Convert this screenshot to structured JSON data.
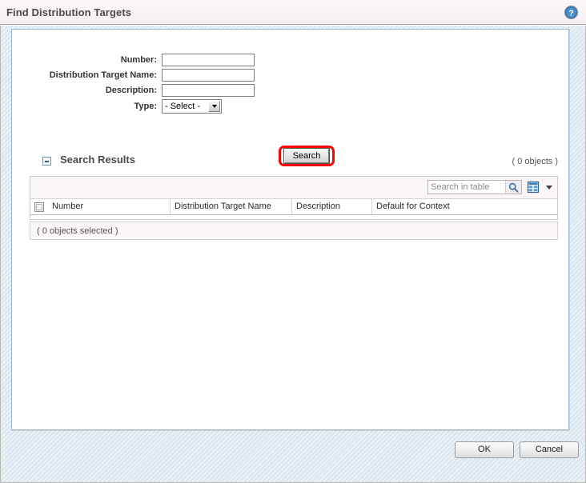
{
  "window": {
    "title": "Find Distribution Targets",
    "help_icon": "help-question-icon"
  },
  "criteria": {
    "fields": [
      {
        "label": "Number:",
        "value": "",
        "placeholder": ""
      },
      {
        "label": "Distribution Target Name:",
        "value": "",
        "placeholder": ""
      },
      {
        "label": "Description:",
        "value": "",
        "placeholder": ""
      }
    ],
    "type_field": {
      "label": "Type:",
      "selected": "- Select -"
    },
    "search_button": "Search"
  },
  "results": {
    "title": "Search Results",
    "collapse_icon": "collapse-minus-icon",
    "object_count": "( 0 objects )",
    "toolbar": {
      "search_placeholder": "Search in table",
      "search_value": "",
      "search_icon": "magnifier-icon",
      "grid_icon": "table-grid-icon",
      "dropdown_icon": "chevron-down-icon"
    },
    "columns": [
      "Number",
      "Distribution Target Name",
      "Description",
      "Default for Context"
    ],
    "rows": [],
    "selected_text": "( 0 objects selected )"
  },
  "footer": {
    "ok_label": "OK",
    "cancel_label": "Cancel"
  },
  "colors": {
    "highlight": "#ff0000",
    "titlebar": "#faf4f6",
    "panel_border": "#9cb8cc",
    "body_bg": "#dde7ef",
    "accent_blue": "#2a6496"
  }
}
